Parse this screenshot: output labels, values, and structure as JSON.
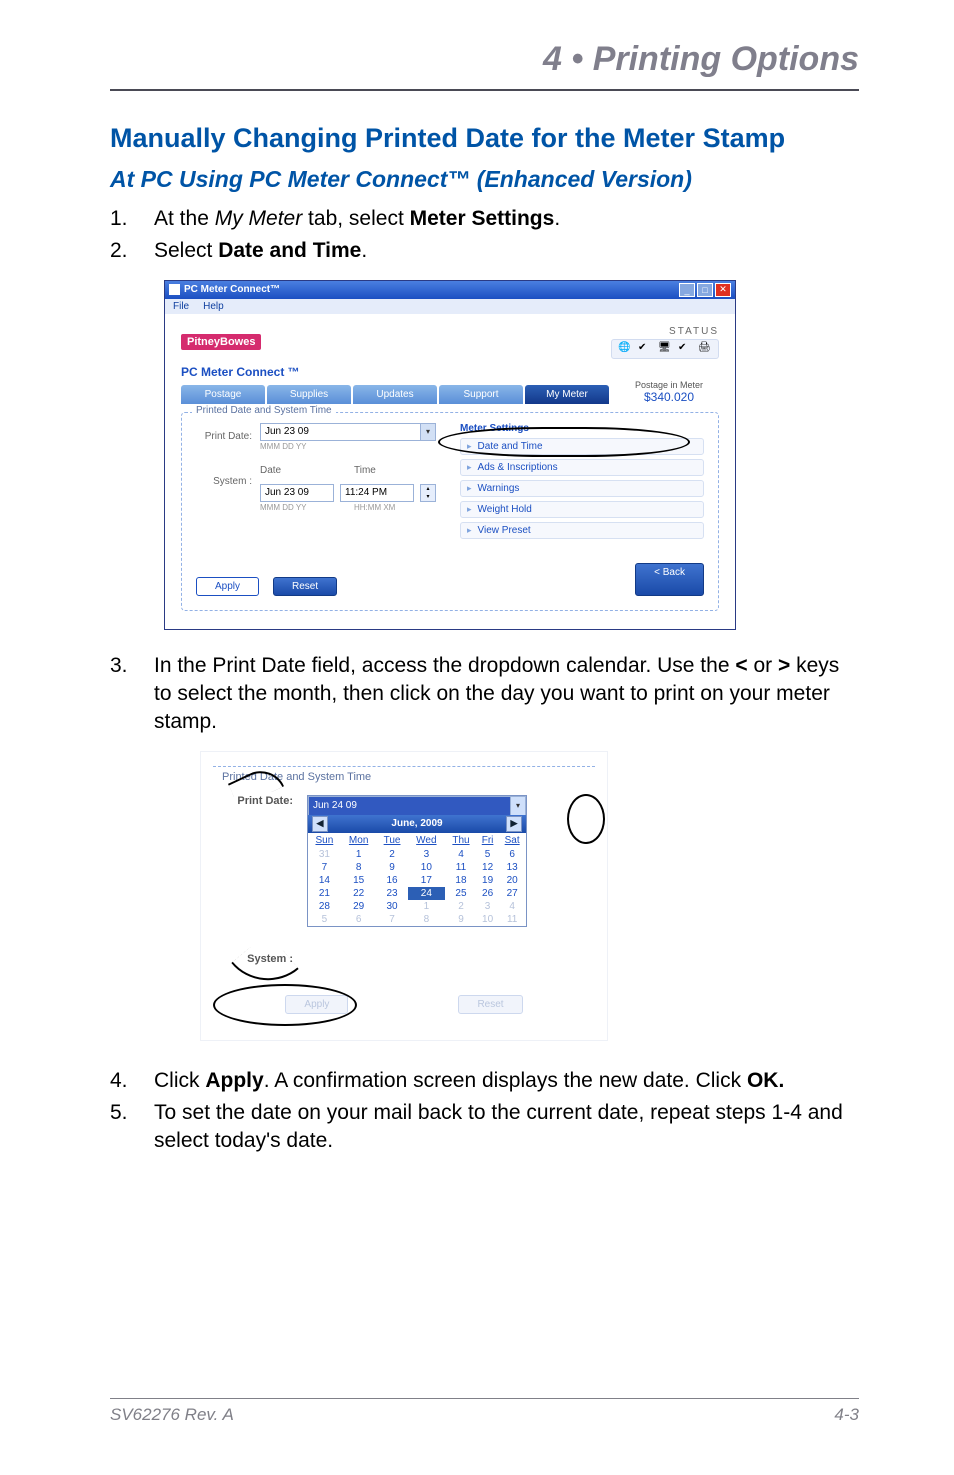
{
  "chapter": "4 • Printing Options",
  "h1": "Manually Changing Printed Date for the Meter Stamp",
  "h2": "At PC Using PC Meter Connect™ (Enhanced Version)",
  "step1": {
    "num": "1.",
    "pre": "At the ",
    "it": "My Meter",
    "mid": " tab, select ",
    "bold": "Meter Settings",
    "post": "."
  },
  "step2": {
    "num": "2.",
    "pre": "Select ",
    "bold": "Date and Time",
    "post": "."
  },
  "step3": {
    "num": "3.",
    "line1": "In the Print Date field, access the dropdown calendar. Use the ",
    "lt": "<",
    "line2": "or ",
    "gt": ">",
    "line3": " keys to select the month, then click on the day you want to print on your meter stamp."
  },
  "step4": {
    "num": "4.",
    "a": "Click ",
    "apply": "Apply",
    "b": ". A confirmation screen displays the new date. Click ",
    "ok": "OK."
  },
  "step5": {
    "num": "5.",
    "text": "To set the date on your mail back to the current date, repeat steps 1-4 and select today's date."
  },
  "shot1": {
    "title": "PC Meter Connect™",
    "menu": {
      "file": "File",
      "help": "Help"
    },
    "brand": "PitneyBowes",
    "status_label": "STATUS",
    "appname": "PC Meter Connect ™",
    "tabs": {
      "postage": "Postage",
      "supplies": "Supplies",
      "updates": "Updates",
      "support": "Support",
      "mymeter": "My Meter"
    },
    "postage_in_meter_label": "Postage in Meter",
    "postage_in_meter_amount": "$340.020",
    "panel_legend": "Printed Date and System Time",
    "print_date_label": "Print Date:",
    "print_date_value": "Jun 23 09",
    "print_date_fmt": "MMM DD YY",
    "sys_label": "System :",
    "sys_date_hdr": "Date",
    "sys_time_hdr": "Time",
    "sys_date": "Jun  23 09",
    "sys_time": "11:24 PM",
    "sys_date_fmt": "MMM DD YY",
    "sys_time_fmt": "HH:MM XM",
    "settings_hdr": "Meter Settings",
    "settings": {
      "a": "Date and Time",
      "b": "Ads & Inscriptions",
      "c": "Warnings",
      "d": "Weight Hold",
      "e": "View Preset"
    },
    "apply": "Apply",
    "reset": "Reset",
    "back": "< Back"
  },
  "shot2": {
    "panel_legend": "Printed Date and System Time",
    "print_label": "Print Date:",
    "print_value": "Jun 24 09",
    "month": "June, 2009",
    "sys_label": "System :",
    "dow": {
      "su": "Sun",
      "mo": "Mon",
      "tu": "Tue",
      "we": "Wed",
      "th": "Thu",
      "fr": "Fri",
      "sa": "Sat"
    },
    "apply": "Apply",
    "reset": "Reset"
  },
  "footer": {
    "left": "SV62276 Rev. A",
    "right": "4-3"
  }
}
